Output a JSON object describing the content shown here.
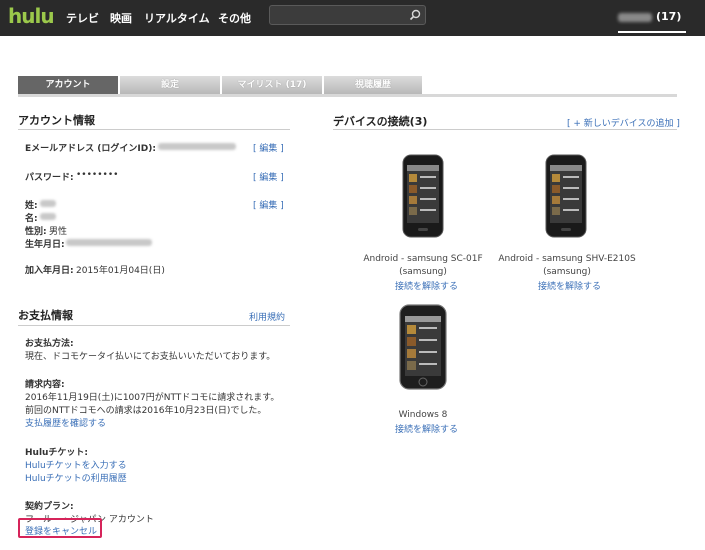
{
  "header": {
    "logo": "hulu",
    "nav": [
      "テレビ",
      "映画",
      "リアルタイム",
      "その他"
    ],
    "search": {
      "placeholder": ""
    },
    "user": {
      "count": "(17)"
    }
  },
  "tabs": [
    {
      "label": "アカウント",
      "active": true
    },
    {
      "label": "設定",
      "active": false
    },
    {
      "label": "マイリスト (17)",
      "active": false
    },
    {
      "label": "視聴履歴",
      "active": false
    }
  ],
  "account": {
    "title": "アカウント情報",
    "email_label": "Eメールアドレス (ログインID):",
    "password_label": "パスワード:",
    "password_value": "••••••••",
    "edit_link": "[ 編集 ]",
    "last_name_label": "姓:",
    "first_name_label": "名:",
    "gender_label": "性別:",
    "gender_value": "男性",
    "birthday_label": "生年月日:",
    "joined_label": "加入年月日:",
    "joined_value": "2015年01月04日(日)"
  },
  "payment": {
    "title": "お支払情報",
    "terms_link": "利用規約",
    "method_label": "お支払方法:",
    "method_value": "現在、ドコモケータイ払いにてお支払いいただいております。",
    "billing_label": "請求内容:",
    "billing_line1": "2016年11月19日(土)に1007円がNTTドコモに請求されます。",
    "billing_line2": "前回のNTTドコモへの請求は2016年10月23日(日)でした。",
    "billing_history_link": "支払履歴を確認する",
    "ticket_label": "Huluチケット:",
    "ticket_enter_link": "Huluチケットを入力する",
    "ticket_history_link": "Huluチケットの利用履歴",
    "plan_label": "契約プラン:",
    "plan_value": "フールー・ジャパン アカウント",
    "cancel_link": "登録をキャンセル"
  },
  "devices": {
    "title": "デバイスの接続(3)",
    "add_link": "[ + 新しいデバイスの追加 ]",
    "unlink_label": "接続を解除する",
    "items": [
      {
        "name_line1": "Android - samsung SC-01F",
        "name_line2": "(samsung)"
      },
      {
        "name_line1": "Android - samsung SHV-E210S",
        "name_line2": "(samsung)"
      },
      {
        "name_line1": "Windows 8",
        "name_line2": ""
      }
    ]
  },
  "colors": {
    "header_bg": "#2a2a2a",
    "logo": "#9bc84b",
    "link": "#3a6fb7",
    "highlight": "#d6245a"
  }
}
